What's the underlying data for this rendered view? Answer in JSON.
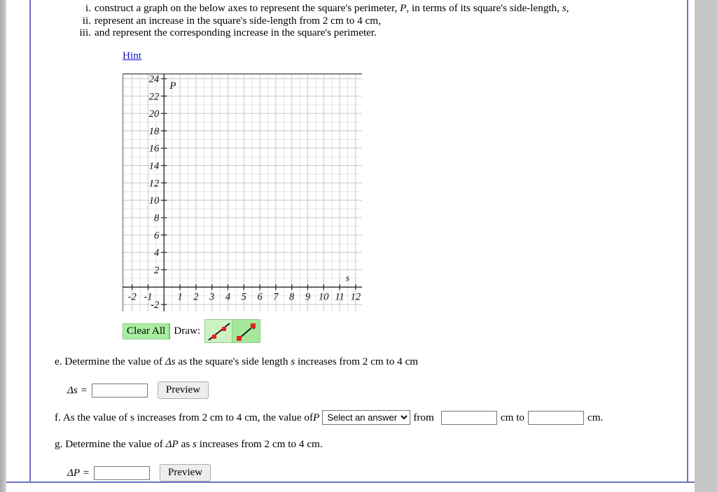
{
  "instructions": {
    "items": [
      {
        "numeral": "i.",
        "text_before": "construct a graph on the below axes to represent the square's perimeter, ",
        "var1": "P",
        "text_mid": ", in terms of its square's side-length, ",
        "var2": "s",
        "text_after": ","
      },
      {
        "numeral": "ii.",
        "text_before": "represent an increase in the square's side-length from 2 cm to 4 cm,",
        "var1": "",
        "text_mid": "",
        "var2": "",
        "text_after": ""
      },
      {
        "numeral": "iii.",
        "text_before": "and represent the corresponding increase in the square's perimeter.",
        "var1": "",
        "text_mid": "",
        "var2": "",
        "text_after": ""
      }
    ]
  },
  "hint": {
    "label": "Hint"
  },
  "graph": {
    "y_axis_label": "P",
    "x_axis_label": "s",
    "y_ticks": [
      "24",
      "22",
      "20",
      "18",
      "16",
      "14",
      "12",
      "10",
      "8",
      "6",
      "4",
      "2",
      "-2"
    ],
    "x_ticks": [
      "-2",
      "-1",
      "1",
      "2",
      "3",
      "4",
      "5",
      "6",
      "7",
      "8",
      "9",
      "10",
      "11",
      "12"
    ],
    "x_range": [
      -2.6,
      12.4
    ],
    "y_range": [
      -2.8,
      24.6
    ],
    "grid_color": "#c8c8c8",
    "minor_grid_color": "#e6e6e6",
    "axis_color": "#333333"
  },
  "toolbar": {
    "clear_all_label": "Clear All",
    "draw_label": "Draw:",
    "tools": [
      {
        "name": "line-segment-tool",
        "selected": true
      },
      {
        "name": "vector-arrow-tool",
        "selected": false
      }
    ],
    "point_color": "#e8221f",
    "stroke_color": "#1a1a1a"
  },
  "questions": {
    "e": {
      "prefix": "e. Determine the value of ",
      "delta_var": "Δs",
      "suffix_a": " as the square's side length ",
      "var_s": "s",
      "suffix_b": " increases from 2 cm to 4 cm",
      "answer_label": "Δs =",
      "answer_value": "",
      "preview_label": "Preview"
    },
    "f": {
      "prefix": "f. As the value of s increases from 2 cm to 4 cm, the value of ",
      "var_p": "P",
      "select_value": "Select an answer",
      "select_options": [
        "Select an answer"
      ],
      "mid_from": "from",
      "value_from": "",
      "mid_cm_to": "cm to",
      "value_to": "",
      "suffix_cm": "cm."
    },
    "g": {
      "prefix": "g. Determine the value of ",
      "delta_var": "ΔP",
      "suffix_a": " as ",
      "var_s": "s",
      "suffix_b": " increases from 2 cm to 4 cm.",
      "answer_label": "ΔP =",
      "answer_value": "",
      "preview_label": "Preview"
    }
  }
}
